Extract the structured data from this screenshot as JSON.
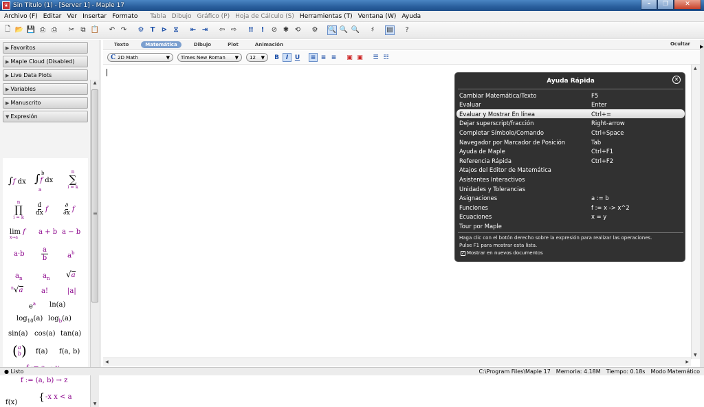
{
  "window": {
    "title": "Sin Título (1) - [Server 1] - Maple 17",
    "app_icon": "maple-leaf-icon",
    "controls": [
      "–",
      "❐",
      "✕"
    ]
  },
  "menu": [
    "Archivo (F)",
    "Editar",
    "Ver",
    "Insertar",
    "Formato",
    "Tabla",
    "Dibujo",
    "Gráfico (P)",
    "Hoja de Cálculo (S)",
    "Herramientas (T)",
    "Ventana (W)",
    "Ayuda"
  ],
  "menu_disabled": [
    5,
    6,
    7,
    8
  ],
  "palettes": {
    "items": [
      "Favoritos",
      "Maple Cloud (Disabled)",
      "Live Data Plots",
      "Variables",
      "Manuscrito",
      "Expresión"
    ],
    "expression": {
      "integral": "∫",
      "integral_f": "f",
      "integral_dx": "dx",
      "def_integral_upper": "b",
      "def_integral_lower": "a",
      "sum_symbol": "∑",
      "sum_upper": "n",
      "sum_lower": "i = k",
      "prod_symbol": "∏",
      "deriv_num": "d",
      "deriv_den": "dx",
      "partial_num": "∂",
      "partial_den": "∂x",
      "lim": "lim",
      "lim_sub": "x→a",
      "a_plus_b": "a + b",
      "a_minus_b": "a − b",
      "a_dot_b": "a·b",
      "frac_a": "a",
      "frac_b": "b",
      "power": "a",
      "power_exp": "b",
      "sub_a": "a",
      "sub_n": "n",
      "sqrt": "√",
      "sqrt_arg": "a",
      "nroot": "√",
      "nroot_n": "n",
      "factorial": "a!",
      "abs": "|a|",
      "exp": "e",
      "exp_a": "a",
      "ln": "ln(a)",
      "log10": "log",
      "log10_sub": "10",
      "log10_arg": "(a)",
      "logb": "log",
      "logb_sub": "b",
      "logb_arg": "(a)",
      "sin": "sin(a)",
      "cos": "cos(a)",
      "tan": "tan(a)",
      "vector_a": "a",
      "vector_b": "b",
      "fa": "f(a)",
      "fab": "f(a, b)",
      "map1": "f := a → y",
      "map2": "f := (a, b) → z",
      "piecewise_lhs": "f(x)",
      "piecewise_row": "-x   x < a"
    }
  },
  "doc": {
    "mode_tabs": [
      "Texto",
      "Matemática",
      "Dibujo",
      "Plot",
      "Animación"
    ],
    "active_mode": "Matemática",
    "hide_label": "Ocultar",
    "style_dropdown": "2D Math",
    "style_glyph": "C",
    "font_dropdown": "Times New Roman",
    "size_dropdown": "12",
    "bold": "B",
    "italic": "I",
    "underline": "U"
  },
  "quick_help": {
    "title": "Ayuda Rápida",
    "rows": [
      {
        "label": "Cambiar Matemática/Texto",
        "key": "F5"
      },
      {
        "label": "Evaluar",
        "key": "Enter"
      },
      {
        "label": "Evaluar y Mostrar En línea",
        "key": "Ctrl+="
      },
      {
        "label": "Dejar superscript/fracción",
        "key": "Right-arrow"
      },
      {
        "label": "Completar Símbolo/Comando",
        "key": "Ctrl+Space"
      },
      {
        "label": "Navegador por Marcador de Posición",
        "key": "Tab"
      },
      {
        "label": "Ayuda de Maple",
        "key": "Ctrl+F1"
      },
      {
        "label": "Referencia Rápida",
        "key": "Ctrl+F2"
      },
      {
        "label": "Atajos del Editor de Matemática",
        "key": ""
      },
      {
        "label": "Asistentes Interactivos",
        "key": ""
      },
      {
        "label": "Unidades y Tolerancias",
        "key": ""
      },
      {
        "label": "Asignaciones",
        "key": "a := b"
      },
      {
        "label": "Funciones",
        "key": "f := x -> x^2"
      },
      {
        "label": "Ecuaciones",
        "key": "x = y"
      },
      {
        "label": "Tour por Maple",
        "key": ""
      }
    ],
    "selected_index": 2,
    "note1": "Haga clic con el botón derecho sobre la expresión para realizar las operaciones.",
    "note2": "Pulse F1 para mostrar esta lista.",
    "checkbox_label": "Mostrar en nuevos documentos",
    "checkbox_checked": true
  },
  "status": {
    "left": "Listo",
    "path": "C:\\Program Files\\Maple 17",
    "memory": "Memoria: 4.18M",
    "time": "Tiempo: 0.18s",
    "mode": "Modo Matemático"
  }
}
